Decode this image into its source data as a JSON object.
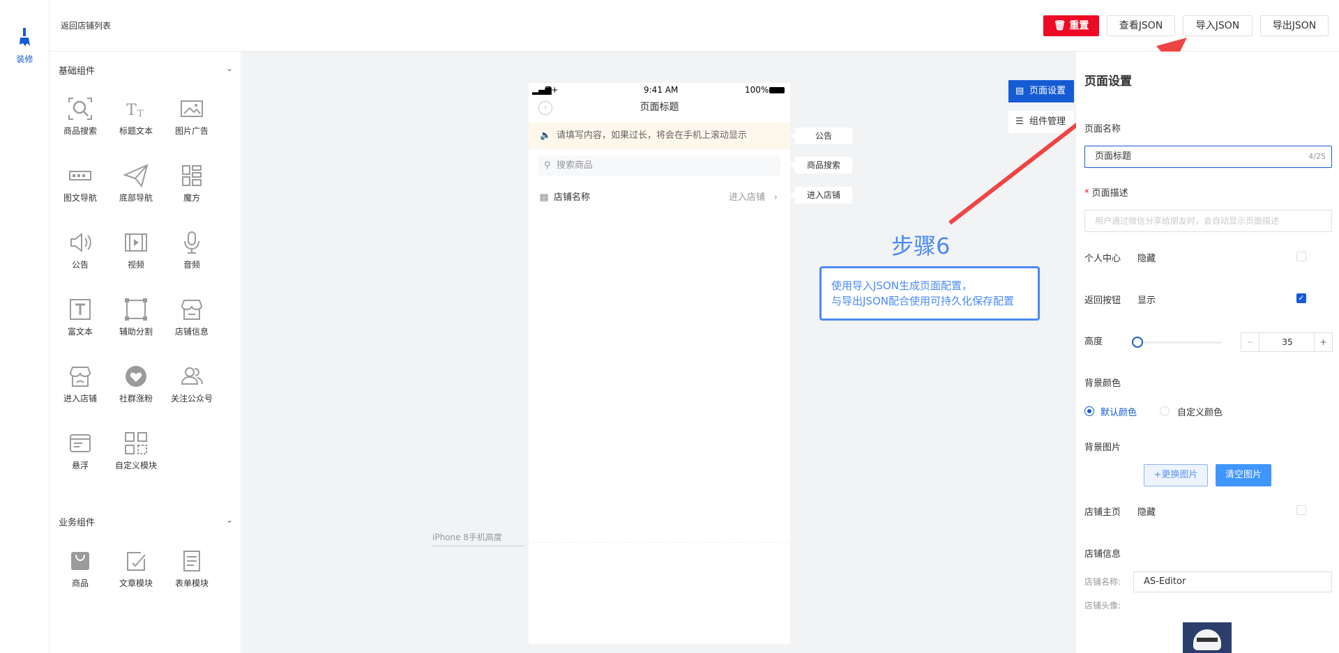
{
  "rail": {
    "tool_label": "装修"
  },
  "topbar": {
    "back_label": "返回店铺列表",
    "reset_label": "重置",
    "view_json_label": "查看JSON",
    "import_json_label": "导入JSON",
    "export_json_label": "导出JSON"
  },
  "palette": {
    "basic_title": "基础组件",
    "business_title": "业务组件",
    "basic_items": [
      "商品搜索",
      "标题文本",
      "图片广告",
      "图文导航",
      "底部导航",
      "魔方",
      "公告",
      "视频",
      "音频",
      "富文本",
      "辅助分割",
      "店铺信息",
      "进入店铺",
      "社群涨粉",
      "关注公众号",
      "悬浮",
      "自定义模块"
    ],
    "business_items": [
      "商品",
      "文章模块",
      "表单模块"
    ]
  },
  "phone": {
    "carrier": "Z+",
    "time": "9:41 AM",
    "battery": "100%",
    "nav_title": "页面标题",
    "notice_text": "请填写内容，如果过长，将会在手机上滚动显示",
    "search_placeholder": "搜索商品",
    "shop_name": "店铺名称",
    "enter_shop": "进入店铺"
  },
  "hints": {
    "notice": "公告",
    "search": "商品搜索",
    "enter_shop": "进入店铺"
  },
  "iphone_label": "iPhone 8手机高度",
  "side_tabs": {
    "page_settings": "页面设置",
    "component_mgmt": "组件管理"
  },
  "annotation": {
    "step": "步骤6",
    "line1": "使用导入JSON生成页面配置，",
    "line2": "与导出JSON配合使用可持久化保存配置",
    "arrow_color": "#ef4444"
  },
  "panel": {
    "title": "页面设置",
    "page_name_label": "页面名称",
    "page_name_value": "页面标题",
    "page_name_count": "4/25",
    "desc_label": "页面描述",
    "desc_placeholder": "用户通过微信分享给朋友时，会自动显示页面描述",
    "personal_label": "个人中心",
    "personal_value": "隐藏",
    "back_btn_label": "返回按钮",
    "back_btn_value": "显示",
    "height_label": "高度",
    "height_value": "35",
    "bg_color_label": "背景颜色",
    "bg_default": "默认颜色",
    "bg_custom": "自定义颜色",
    "bg_image_label": "背景图片",
    "change_image": "+更换图片",
    "clear_image": "清空图片",
    "shop_home_label": "店铺主页",
    "shop_home_value": "隐藏",
    "shop_info_label": "店铺信息",
    "shop_name_label": "店铺名称:",
    "shop_name_value": "AS-Editor",
    "shop_avatar_label": "店铺头像:"
  },
  "colors": {
    "accent": "#155bd4",
    "danger": "#ee0a24",
    "annotation": "#4a8af4"
  }
}
